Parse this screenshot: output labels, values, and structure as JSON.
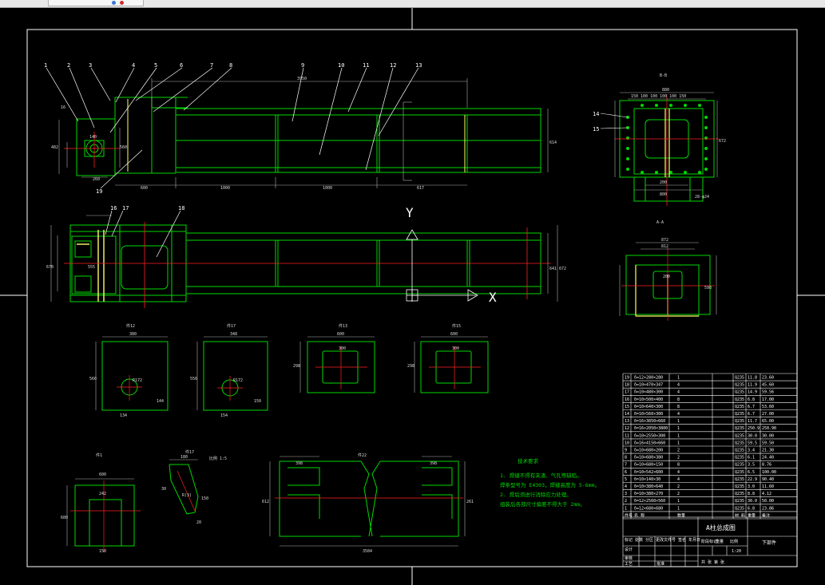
{
  "colors": {
    "background": "#000000",
    "frame": "#ffffff",
    "outline": "#00d800",
    "hidden": "#ffff66",
    "centerline": "#ff2020",
    "dimension": "#b0b0b0",
    "annotation": "#ffffff"
  },
  "toolbar_icons": [
    "window-icon",
    "close-icon"
  ],
  "balloons": [
    "1",
    "2",
    "3",
    "4",
    "5",
    "6",
    "7",
    "8",
    "9",
    "10",
    "11",
    "12",
    "13",
    "14",
    "15",
    "16",
    "17",
    "18",
    "19"
  ],
  "views": {
    "bb_title": "B-B",
    "aa_title": "A-A",
    "axis_y": "Y",
    "axis_x": "X"
  },
  "dims": {
    "front_top": "3950",
    "front_b1": "600",
    "front_b2": "1000",
    "front_b3": "1000",
    "front_b4": "617",
    "front_h": "614",
    "front_side_a": "482",
    "front_side_b": "560",
    "front_side_c": "260",
    "front_side_d": "140",
    "front_small": "16",
    "plan_a": "670",
    "plan_b": "555",
    "plan_c": "641",
    "plan_d": "672",
    "bb_top": "880",
    "bb_seg": "150  100  100  100  100  150",
    "bb_bot1": "200",
    "bb_bot2": "800",
    "bb_bolt": "28-φ24",
    "bb_side": "672",
    "aa_a": "872",
    "aa_b": "812",
    "aa_c": "200",
    "aa_d": "598"
  },
  "details": [
    {
      "title": "件12",
      "w": "380",
      "h": "560",
      "r": "R172",
      "a": "134",
      "b": "144"
    },
    {
      "title": "件17",
      "w": "348",
      "h": "556",
      "r": "R172",
      "a": "154",
      "b": "150"
    },
    {
      "title": "件13",
      "w": "600",
      "h": "298",
      "r": "300"
    },
    {
      "title": "件15",
      "w": "600",
      "h": "298",
      "r": "300"
    }
  ],
  "lower_details": {
    "d1_title": "件1",
    "d1_w": "600",
    "d1_inner": "242",
    "d1_h": "680",
    "d1_b": "150",
    "d2_title": "件17",
    "d2_sub": "比例 1:5",
    "d2_w": "180",
    "d2_a": "30",
    "d2_b": "150",
    "d2_c": "20",
    "d2_d": "R(3)",
    "d3_title": "件22",
    "d3_w": "3584",
    "d3_a": "398",
    "d3_b": "398",
    "d3_h": "612",
    "d3_c": "261"
  },
  "notes": {
    "title": "技术要求",
    "lines": [
      "1. 焊缝不得有夹渣、气孔等缺陷。",
      "焊条型号为 E4303，焊缝高度为 5-6mm。",
      "2. 焊后须进行消除应力处理。",
      "组装后各部尺寸偏差不得大于 2mm。"
    ]
  },
  "bom": {
    "rows": [
      [
        "19",
        "δ=12×280×280",
        "1",
        "Q235",
        "11.8",
        "23.60"
      ],
      [
        "18",
        "δ=10×470×347",
        "4",
        "Q235",
        "11.9",
        "45.60"
      ],
      [
        "17",
        "δ=10×480×300",
        "4",
        "Q235",
        "14.9",
        "59.56"
      ],
      [
        "16",
        "δ=10×500×400",
        "8",
        "Q235",
        "6.8",
        "17.00"
      ],
      [
        "15",
        "δ=10×640×300",
        "8",
        "Q235",
        "6.7",
        "53.60"
      ],
      [
        "14",
        "δ=10×560×300",
        "4",
        "Q235",
        "6.7",
        "27.00"
      ],
      [
        "13",
        "δ=16×3850×660",
        "1",
        "Q235",
        "11.7",
        "65.00"
      ],
      [
        "12",
        "δ=16×2050×3800",
        "1",
        "Q235",
        "250.9",
        "250.90"
      ],
      [
        "11",
        "δ=10×2550×300",
        "1",
        "Q235",
        "30.0",
        "30.00"
      ],
      [
        "10",
        "δ=16×4150×660",
        "1",
        "Q235",
        "59.5",
        "59.50"
      ],
      [
        "9",
        "δ=10×680×200",
        "2",
        "Q235",
        "3.4",
        "21.30"
      ],
      [
        "8",
        "δ=10×680×380",
        "2",
        "Q235",
        "6.1",
        "24.40"
      ],
      [
        "7",
        "δ=10×680×150",
        "8",
        "Q235",
        "3.5",
        "8.76"
      ],
      [
        "6",
        "δ=10×542×600",
        "4",
        "Q235",
        "6.5",
        "100.00"
      ],
      [
        "5",
        "δ=10×140×30",
        "4",
        "Q235",
        "22.9",
        "90.40"
      ],
      [
        "4",
        "δ=10×380×640",
        "2",
        "Q235",
        "3.0",
        "11.60"
      ],
      [
        "3",
        "δ=10×380×270",
        "2",
        "Q235",
        "8.8",
        "4.12"
      ],
      [
        "2",
        "δ=12×2560×560",
        "1",
        "Q235",
        "30.0",
        "50.00"
      ],
      [
        "1",
        "δ=12×680×680",
        "1",
        "Q235",
        "6.8",
        "23.86"
      ]
    ],
    "headers": [
      "件号",
      "名 称",
      "数量",
      "材 料",
      "重量",
      "备注"
    ]
  },
  "title_block": {
    "drawing_name": "A柱总成图",
    "unit_note": "下部件",
    "rows": [
      "标记 处数 分区 更改文件号 签名 年月日",
      "设计",
      "审核",
      "工艺",
      "批准"
    ],
    "stage": "阶段标记",
    "weight": "重量",
    "scale": "比例",
    "scale_val": "1:20",
    "sheet": "共 张 第 张"
  }
}
